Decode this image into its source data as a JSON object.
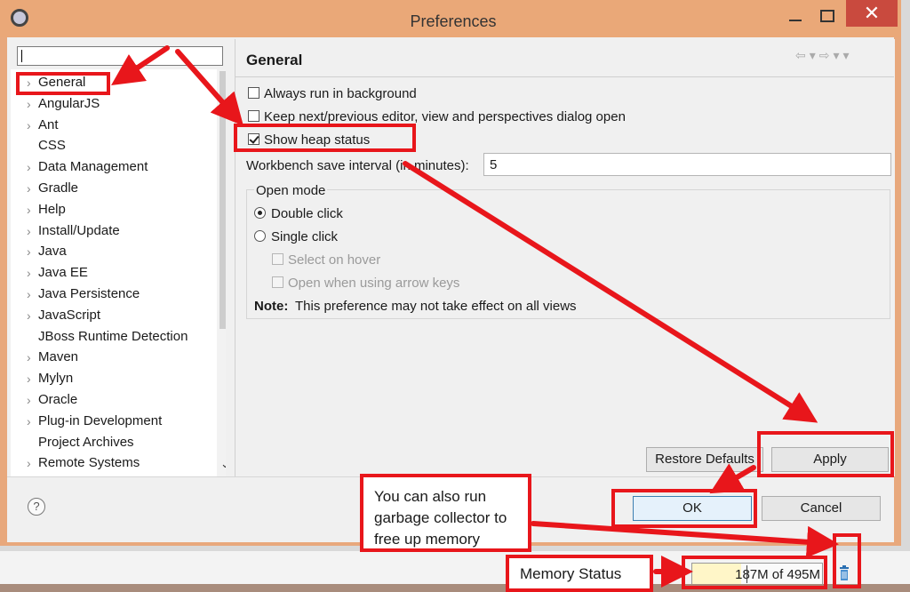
{
  "window": {
    "title": "Preferences",
    "close_glyph": "✕"
  },
  "filter": {
    "value": ""
  },
  "tree": {
    "items": [
      {
        "label": "General",
        "expandable": true
      },
      {
        "label": "AngularJS",
        "expandable": true
      },
      {
        "label": "Ant",
        "expandable": true
      },
      {
        "label": "CSS",
        "expandable": false
      },
      {
        "label": "Data Management",
        "expandable": true
      },
      {
        "label": "Gradle",
        "expandable": true
      },
      {
        "label": "Help",
        "expandable": true
      },
      {
        "label": "Install/Update",
        "expandable": true
      },
      {
        "label": "Java",
        "expandable": true
      },
      {
        "label": "Java EE",
        "expandable": true
      },
      {
        "label": "Java Persistence",
        "expandable": true
      },
      {
        "label": "JavaScript",
        "expandable": true
      },
      {
        "label": "JBoss Runtime Detection",
        "expandable": false
      },
      {
        "label": "Maven",
        "expandable": true
      },
      {
        "label": "Mylyn",
        "expandable": true
      },
      {
        "label": "Oracle",
        "expandable": true
      },
      {
        "label": "Plug-in Development",
        "expandable": true
      },
      {
        "label": "Project Archives",
        "expandable": false
      },
      {
        "label": "Remote Systems",
        "expandable": true
      }
    ]
  },
  "general": {
    "title": "General",
    "always_run_background": {
      "label": "Always run in background",
      "checked": false
    },
    "keep_next_previous": {
      "label": "Keep next/previous editor, view and perspectives dialog open",
      "checked": false
    },
    "show_heap_status": {
      "label": "Show heap status",
      "checked": true
    },
    "save_interval_label": "Workbench save interval (in minutes):",
    "save_interval_value": "5",
    "open_mode": {
      "label": "Open mode",
      "double_click": "Double click",
      "single_click": "Single click",
      "select_on_hover": "Select on hover",
      "open_arrow_keys": "Open when using arrow keys",
      "selected": "Double click"
    },
    "note_bold": "Note:",
    "note_text": "This preference may not take effect on all views"
  },
  "buttons": {
    "restore_defaults": "Restore Defaults",
    "apply": "Apply",
    "ok": "OK",
    "cancel": "Cancel"
  },
  "help_icon": "?",
  "status": {
    "heap_text": "187M of 495M",
    "heap_used_fraction": 0.378
  },
  "annotations": {
    "gc_callout": "You can also run garbage collector to free up memory",
    "memory_label": "Memory Status"
  },
  "colors": {
    "annotation_red": "#e8161b",
    "title_bar": "#eaa878",
    "close_button": "#c94a3e",
    "heap_fill": "#fff6c8"
  }
}
